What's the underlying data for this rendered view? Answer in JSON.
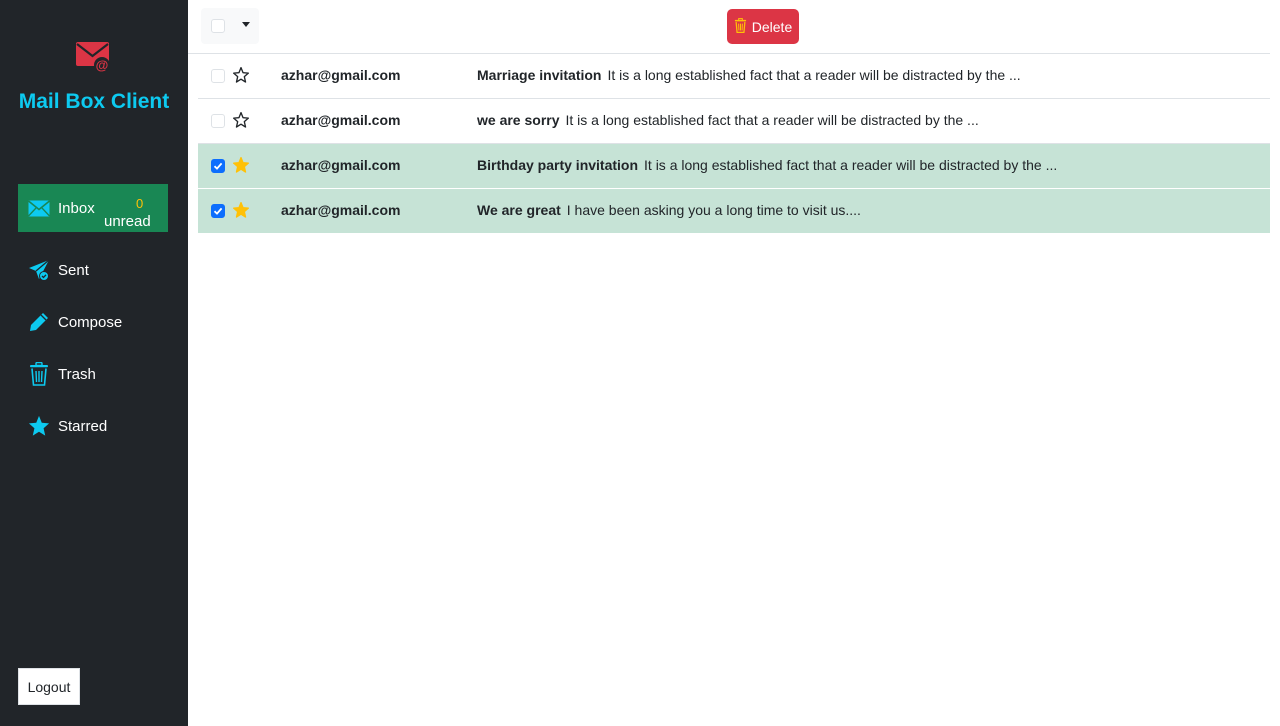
{
  "brand": {
    "title": "Mail Box Client",
    "icon": "envelope-at-icon"
  },
  "nav": {
    "inbox": {
      "label": "Inbox",
      "unread_count": "0",
      "unread_label": "unread"
    },
    "sent": {
      "label": "Sent"
    },
    "compose": {
      "label": "Compose"
    },
    "trash": {
      "label": "Trash"
    },
    "starred": {
      "label": "Starred"
    }
  },
  "logout_label": "Logout",
  "toolbar": {
    "delete_label": "Delete"
  },
  "mails": [
    {
      "sender": "azhar@gmail.com",
      "subject": "Marriage invitation",
      "preview": "It is a long established fact that a reader will be distracted by the ...",
      "checked": false,
      "starred": false
    },
    {
      "sender": "azhar@gmail.com",
      "subject": "we are sorry",
      "preview": "It is a long established fact that a reader will be distracted by the ...",
      "checked": false,
      "starred": false
    },
    {
      "sender": "azhar@gmail.com",
      "subject": "Birthday party invitation",
      "preview": "It is a long established fact that a reader will be distracted by the ...",
      "checked": true,
      "starred": true
    },
    {
      "sender": "azhar@gmail.com",
      "subject": "We are great",
      "preview": "I have been asking you a long time to visit us....",
      "checked": true,
      "starred": true
    }
  ],
  "colors": {
    "sidebar_bg": "#212529",
    "accent_cyan": "#0dcaf0",
    "active_green": "#198754",
    "delete_red": "#dc3545",
    "star_yellow": "#ffc107",
    "selected_row": "#c6e3d6"
  }
}
